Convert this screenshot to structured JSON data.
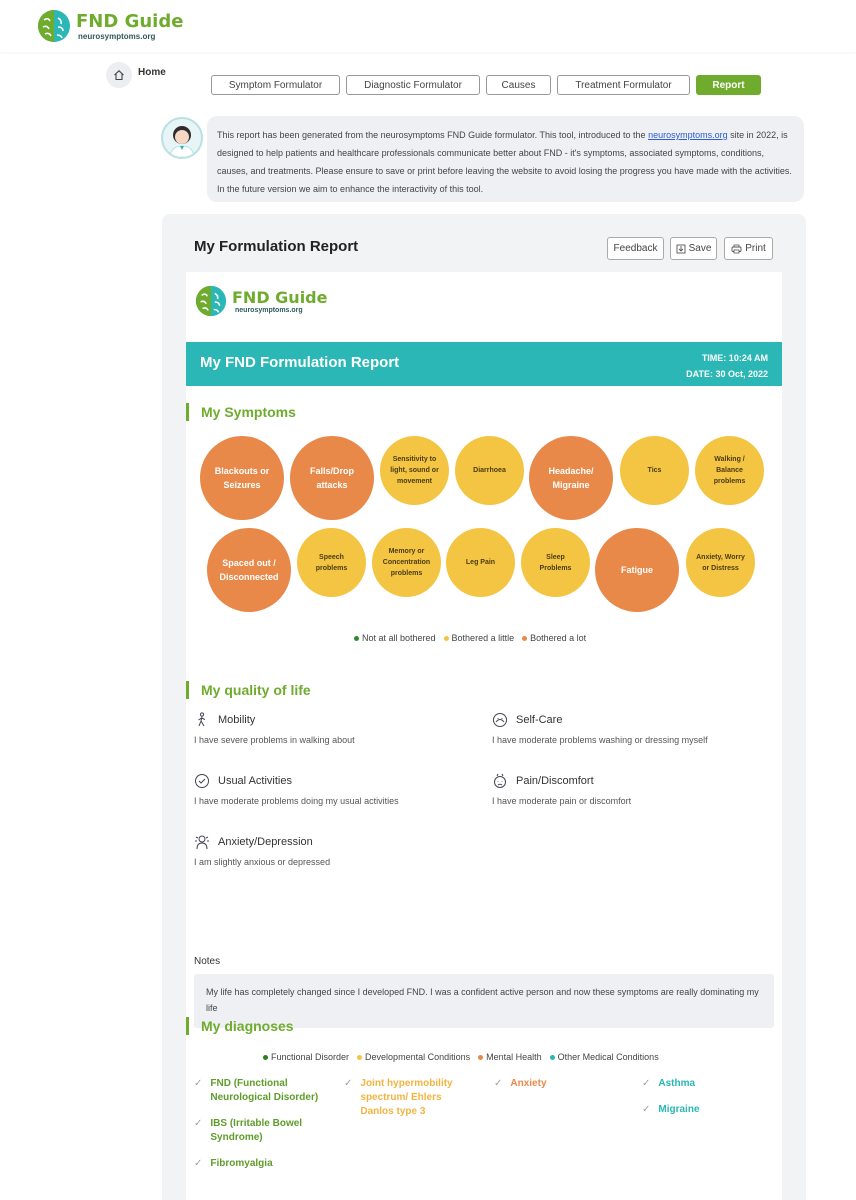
{
  "header": {
    "logo_title": "FND Guide",
    "logo_subtitle": "neurosymptoms.org",
    "home_label": "Home"
  },
  "tabs": [
    {
      "label": "Symptom Formulator",
      "active": false
    },
    {
      "label": "Diagnostic Formulator",
      "active": false
    },
    {
      "label": "Causes",
      "active": false
    },
    {
      "label": "Treatment Formulator",
      "active": false
    },
    {
      "label": "Report",
      "active": true
    }
  ],
  "intro": {
    "text_before_link": "This report has been generated from the neurosymptoms FND Guide formulator. This tool, introduced to the ",
    "link_text": "neurosymptoms.org",
    "text_after_link": " site in 2022, is designed to help patients and healthcare professionals communicate better about FND - it's symptoms, associated symptoms, conditions, causes, and treatments. Please ensure to save or print before leaving the website to avoid losing the progress you have made with the activities. In the future version we aim to enhance the interactivity of this tool."
  },
  "report": {
    "title": "My Formulation Report",
    "feedback_label": "Feedback",
    "save_label": "Save",
    "print_label": "Print",
    "paper_logo_title": "FND Guide",
    "paper_logo_subtitle": "neurosymptoms.org",
    "banner_title": "My FND Formulation Report",
    "time_text": "TIME: 10:24 AM",
    "date_text": "DATE: 30 Oct, 2022"
  },
  "symptoms": {
    "heading": "My Symptoms",
    "items": [
      {
        "label": "Blackouts or Seizures",
        "level": "lot"
      },
      {
        "label": "Falls/Drop attacks",
        "level": "lot"
      },
      {
        "label": "Sensitivity to light, sound or movement",
        "level": "little"
      },
      {
        "label": "Diarrhoea",
        "level": "little"
      },
      {
        "label": "Headache/ Migraine",
        "level": "lot"
      },
      {
        "label": "Tics",
        "level": "little"
      },
      {
        "label": "Walking / Balance problems",
        "level": "little"
      },
      {
        "label": "Spaced out / Disconnected",
        "level": "lot"
      },
      {
        "label": "Speech problems",
        "level": "little"
      },
      {
        "label": "Memory or Concentration problems",
        "level": "little"
      },
      {
        "label": "Leg Pain",
        "level": "little"
      },
      {
        "label": "Sleep Problems",
        "level": "little"
      },
      {
        "label": "Fatigue",
        "level": "lot"
      },
      {
        "label": "Anxiety, Worry or Distress",
        "level": "little"
      }
    ],
    "legend": [
      {
        "label": "Not at all bothered",
        "color": "#2e8b2e"
      },
      {
        "label": "Bothered a little",
        "color": "#f4c543"
      },
      {
        "label": "Bothered a lot",
        "color": "#e8894a"
      }
    ]
  },
  "quality": {
    "heading": "My quality of life",
    "items": [
      {
        "title": "Mobility",
        "desc": "I have severe problems in walking about",
        "icon": "walking-icon"
      },
      {
        "title": "Self-Care",
        "desc": "I have moderate problems washing or dressing myself",
        "icon": "self-care-icon"
      },
      {
        "title": "Usual Activities",
        "desc": "I have moderate problems doing my usual activities",
        "icon": "activities-icon"
      },
      {
        "title": "Pain/Discomfort",
        "desc": "I have moderate pain or discomfort",
        "icon": "pain-icon"
      },
      {
        "title": "Anxiety/Depression",
        "desc": "I am slightly anxious or depressed",
        "icon": "anxiety-icon"
      }
    ],
    "notes_label": "Notes",
    "notes_text": "My life has completely changed since I developed FND. I was a confident active person and now these symptoms are really dominating my life"
  },
  "diagnoses": {
    "heading": "My diagnoses",
    "legend": [
      {
        "label": "Functional Disorder",
        "color": "#2e7d1e"
      },
      {
        "label": "Developmental Conditions",
        "color": "#f4c543"
      },
      {
        "label": "Mental Health",
        "color": "#e8894a"
      },
      {
        "label": "Other Medical Conditions",
        "color": "#2ab7b5"
      }
    ],
    "functional": [
      "FND (Functional Neurological Disorder)",
      "IBS (Irritable Bowel Syndrome)",
      "Fibromyalgia"
    ],
    "developmental": [
      "Joint hypermobility spectrum/ Ehlers Danlos type 3"
    ],
    "mental": [
      "Anxiety"
    ],
    "other": [
      "Asthma",
      "Migraine"
    ]
  }
}
